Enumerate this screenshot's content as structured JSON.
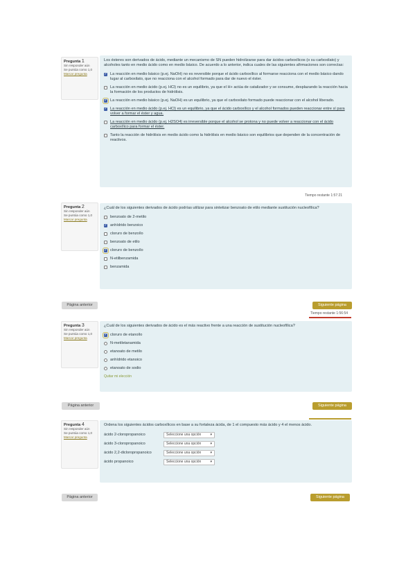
{
  "q1": {
    "info": {
      "label": "Pregunta",
      "num": "1",
      "status": "Sin responder aún",
      "grade": "Se puntúa como 1,0",
      "flag": "Marcar pregunta"
    },
    "text": "Los ésteres son derivados de ácido, mediante un mecanismo de SN pueden hidrolizarse para dar ácidos carboxílicos (o su carboxilato) y alcoholes tanto en medio ácido como en medio básico. De acuerdo a lo anterior, indica cuales de las siguientes afirmaciones son correctas:",
    "options": [
      {
        "text": "La reacción en medio básico (p.ej. NaOH) no es reversible porque el ácido carboxílico al formarse reacciona con el medio básico dando lugar al carboxilato, que no reacciona con el alcohol formado para dar de nuevo el éster.",
        "checked": true,
        "highlight": false,
        "underline": false
      },
      {
        "text": "La reacción en medio ácido (p.ej. HCl) no es un equilibrio, ya que el H+ actúa de catalizador y se consume, desplazando la reacción hacia la formación de los productos de hidrólisis.",
        "checked": false,
        "highlight": false,
        "underline": false
      },
      {
        "text": "La reacción en medio básico (p.ej. NaOH) es un equilibrio, ya que el carboxilato formado puede reaccionar con el alcohol liberado.",
        "checked": true,
        "highlight": true,
        "underline": false
      },
      {
        "text": "La reacción en medio ácido (p.ej. HCl) es un equilibrio, ya que el ácido carboxílico y el alcohol formados pueden reaccionar entre sí para volver a formar el éster y agua.",
        "checked": true,
        "highlight": false,
        "underline": true
      },
      {
        "text": "La reacción en medio ácido (p.ej. H2SO4) es irreversible porque el alcohol se protona y no puede volver a reaccionar con el ácido carboxílico para formar el éster.",
        "checked": false,
        "highlight": false,
        "underline": true
      },
      {
        "text": "Tanto la reacción de hidrólisis en medio ácido como la hidrólisis en medio básico son equilibrios que dependen de la concentración de reactivos.",
        "checked": false,
        "highlight": false,
        "underline": false
      }
    ],
    "time": "Tiempo restante 1:57:21"
  },
  "q2": {
    "info": {
      "label": "Pregunta",
      "num": "2",
      "status": "Sin responder aún",
      "grade": "Se puntúa como 1,0",
      "flag": "Marcar pregunta"
    },
    "text": "¿Cuál de los siguientes derivados de ácido podrías utilizar para sintetizar benzoato de etilo mediante sustitución nucleofílica?",
    "options": [
      {
        "text": "benzoato de 2-metilo",
        "checked": false,
        "highlight": false
      },
      {
        "text": "anhídrido benzoico",
        "checked": true,
        "highlight": false
      },
      {
        "text": "cloruro de benzoílo",
        "checked": false,
        "highlight": false
      },
      {
        "text": "benzoato de etilo",
        "checked": false,
        "highlight": false
      },
      {
        "text": "cloruro de benzoílo",
        "checked": true,
        "highlight": true
      },
      {
        "text": "N-etilbenzamida",
        "checked": false,
        "highlight": false
      },
      {
        "text": "benzamida",
        "checked": false,
        "highlight": false
      }
    ],
    "prev": "Página anterior",
    "next": "Siguiente página",
    "time": "Tiempo restante 1:56:54"
  },
  "q3": {
    "info": {
      "label": "Pregunta",
      "num": "3",
      "status": "Sin responder aún",
      "grade": "Se puntúa como 1,0",
      "flag": "Marcar pregunta"
    },
    "text": "¿Cuál de los siguientes derivados de ácido es el más reactivo frente a una reacción de sustitución nucleofílica?",
    "options": [
      {
        "text": "cloruro de etanoílo",
        "selected": true
      },
      {
        "text": "N-metiletanamida",
        "selected": false
      },
      {
        "text": "etanoato de metilo",
        "selected": false
      },
      {
        "text": "anhídrido etanoico",
        "selected": false
      },
      {
        "text": "etanoato de sodio",
        "selected": false
      }
    ],
    "clear": "Quitar mi elección",
    "prev": "Página anterior",
    "next": "Siguiente página"
  },
  "q4": {
    "info": {
      "label": "Pregunta",
      "num": "4",
      "status": "Sin responder aún",
      "grade": "Se puntúa como 1,0",
      "flag": "Marcar pregunta"
    },
    "text": "Ordena los siguientes ácidos carboxílicos en base a su fortaleza ácida, de 1 el compuesto más ácido y 4 el menos ácido.",
    "rows": [
      {
        "label": "ácido 2-cloropropanoico",
        "value": "Seleccione una opción"
      },
      {
        "label": "ácido 3-cloropropanoico",
        "value": "Seleccione una opción"
      },
      {
        "label": "ácido 2,2-dicloropropanoico",
        "value": "Seleccione una opción"
      },
      {
        "label": "ácido propanoico",
        "value": "Seleccione una opción"
      }
    ],
    "prev": "Página anterior",
    "next": "Siguiente página"
  },
  "colors": {
    "accent": "#b99d2e",
    "panel": "#e5f0f3",
    "check": "#3f5fa8"
  }
}
